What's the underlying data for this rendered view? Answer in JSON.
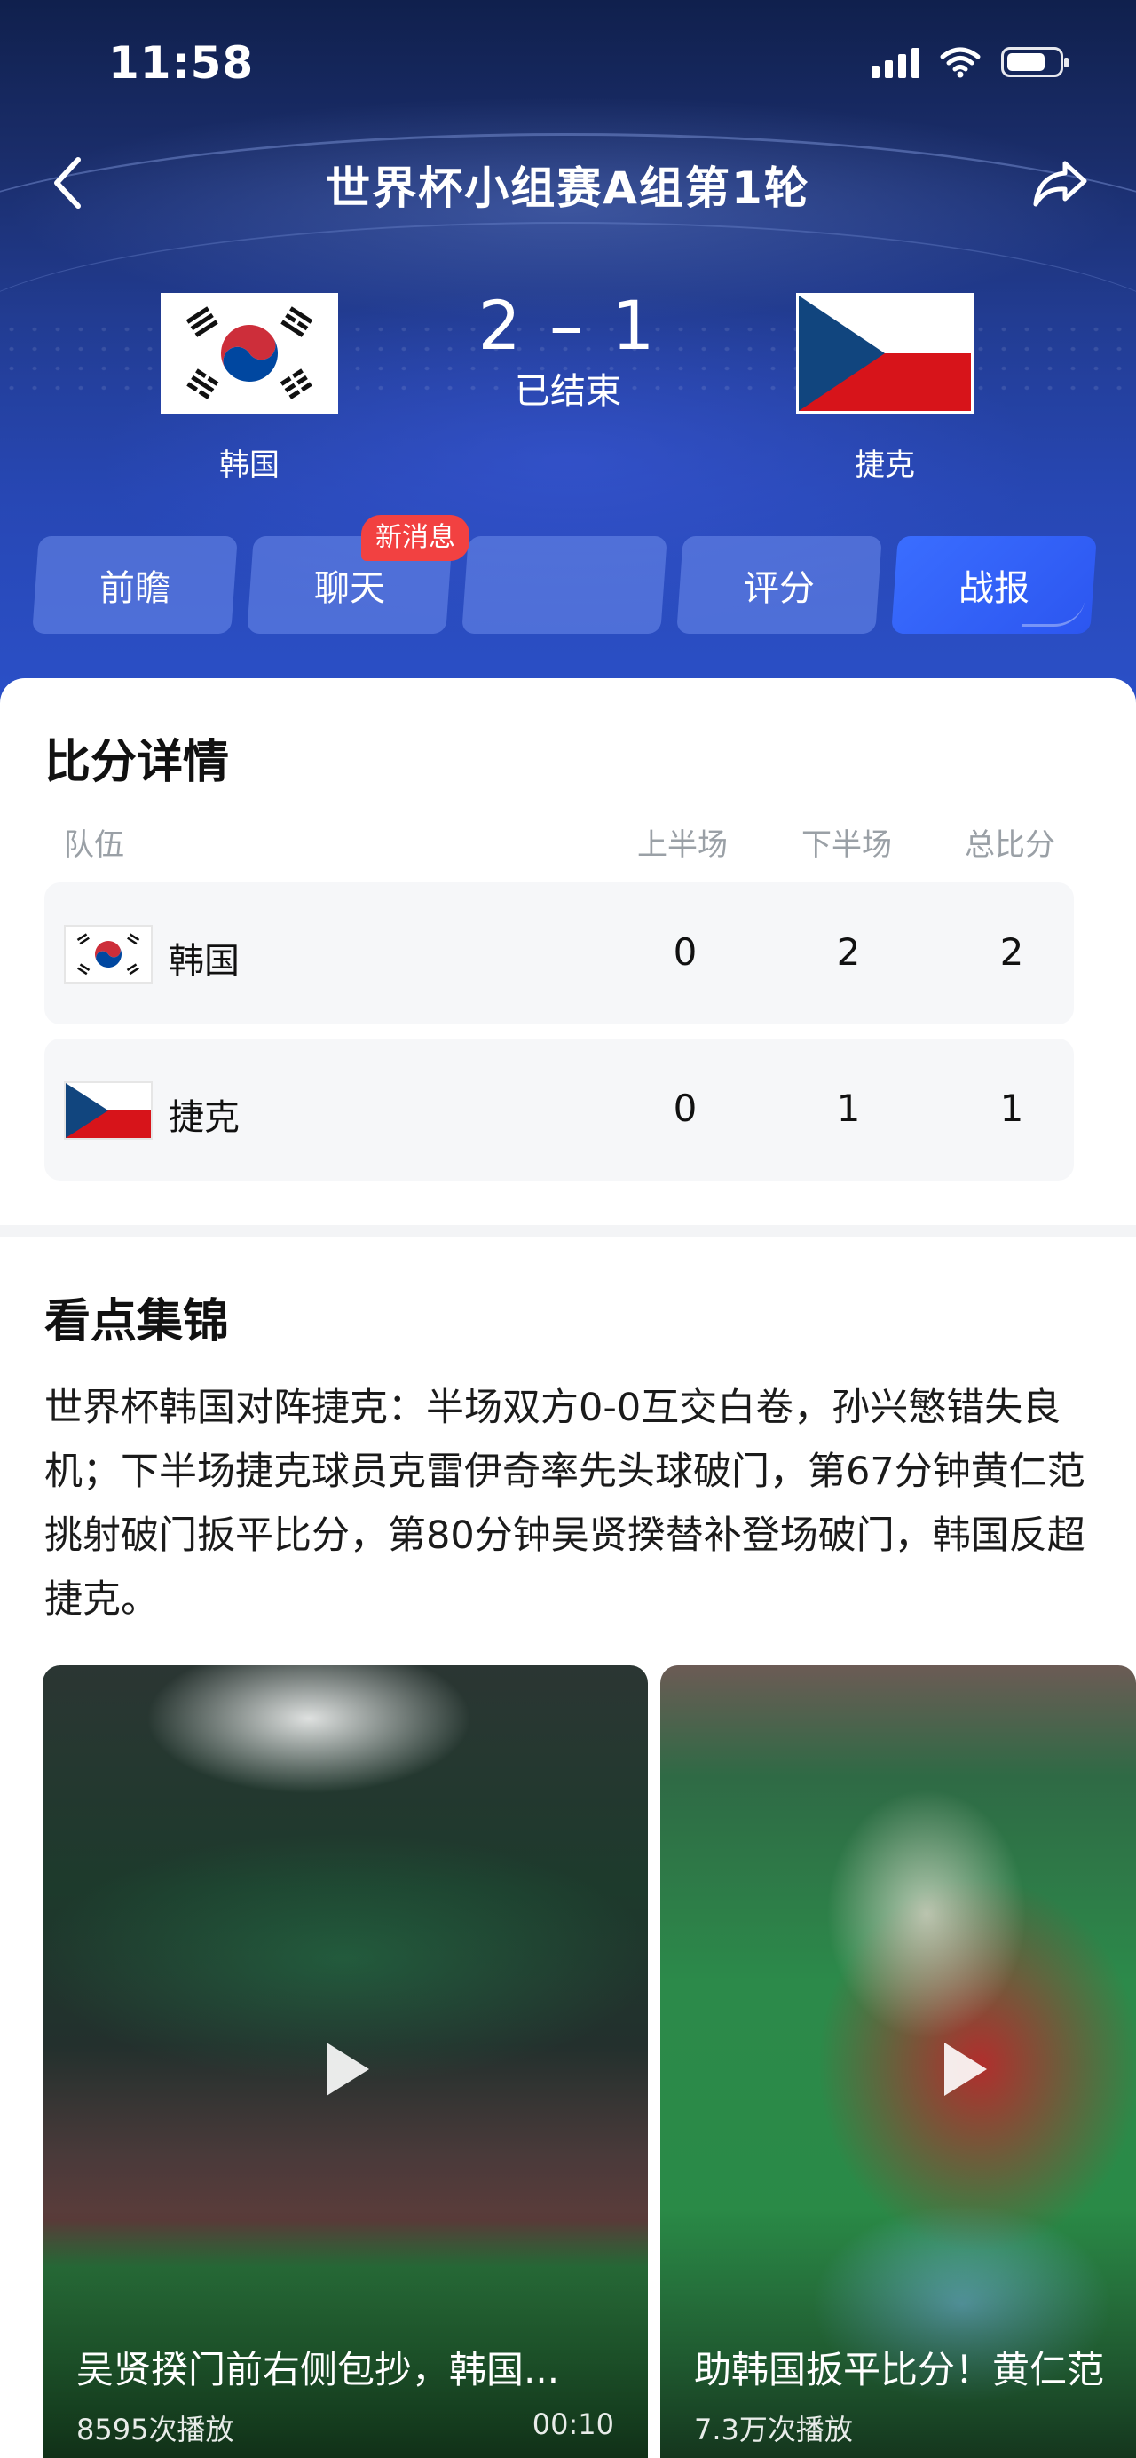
{
  "status_bar": {
    "time": "11:58"
  },
  "nav": {
    "title": "世界杯小组赛A组第1轮"
  },
  "match": {
    "home": {
      "name": "韩国"
    },
    "away": {
      "name": "捷克"
    },
    "score": "2 – 1",
    "status": "已结束"
  },
  "tabs": [
    {
      "label": "前瞻"
    },
    {
      "label": "聊天"
    },
    {
      "label": ""
    },
    {
      "label": "评分"
    },
    {
      "label": "战报"
    }
  ],
  "chat_badge": "新消息",
  "score_detail": {
    "title": "比分详情",
    "headers": {
      "team": "队伍",
      "first_half": "上半场",
      "second_half": "下半场",
      "total": "总比分"
    },
    "rows": [
      {
        "team": "韩国",
        "first_half": "0",
        "second_half": "2",
        "total": "2"
      },
      {
        "team": "捷克",
        "first_half": "0",
        "second_half": "1",
        "total": "1"
      }
    ]
  },
  "highlights": {
    "title": "看点集锦",
    "summary": "世界杯韩国对阵捷克：半场双方0-0互交白卷，孙兴慜错失良机；下半场捷克球员克雷伊奇率先头球破门，第67分钟黄仁范挑射破门扳平比分，第80分钟吴贤揆替补登场破门，韩国反超捷克。",
    "videos": [
      {
        "title": "吴贤揆门前右侧包抄，韩国...",
        "plays": "8595次播放",
        "duration": "00:10"
      },
      {
        "title": "助韩国扳平比分！黄仁范",
        "plays": "7.3万次播放",
        "duration": ""
      }
    ]
  },
  "colors": {
    "accent": "#2c56f0",
    "badge": "#f24141",
    "czech_blue": "#11457e",
    "czech_red": "#d7141a",
    "korea_red": "#cd2e3a",
    "korea_blue": "#0047a0"
  }
}
